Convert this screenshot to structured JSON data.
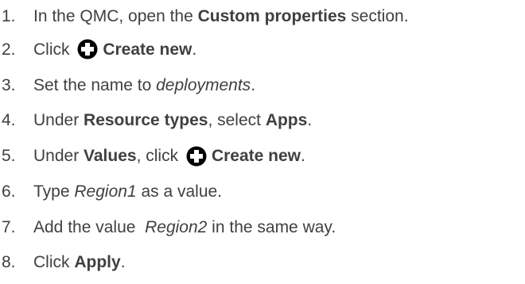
{
  "steps": [
    {
      "number": "1.",
      "parts": [
        {
          "t": "In the QMC, open the ",
          "s": "n"
        },
        {
          "t": "Custom properties",
          "s": "b"
        },
        {
          "t": " section.",
          "s": "n"
        }
      ]
    },
    {
      "number": "2.",
      "parts": [
        {
          "t": "Click ",
          "s": "n"
        },
        {
          "icon": "plus-circle-icon"
        },
        {
          "t": "Create new",
          "s": "b"
        },
        {
          "t": ".",
          "s": "n"
        }
      ]
    },
    {
      "number": "3.",
      "parts": [
        {
          "t": "Set the name to ",
          "s": "n"
        },
        {
          "t": "deployments",
          "s": "i"
        },
        {
          "t": ".",
          "s": "n"
        }
      ]
    },
    {
      "number": "4.",
      "parts": [
        {
          "t": "Under ",
          "s": "n"
        },
        {
          "t": "Resource types",
          "s": "b"
        },
        {
          "t": ", select ",
          "s": "n"
        },
        {
          "t": "Apps",
          "s": "b"
        },
        {
          "t": ".",
          "s": "n"
        }
      ]
    },
    {
      "number": "5.",
      "parts": [
        {
          "t": "Under ",
          "s": "n"
        },
        {
          "t": "Values",
          "s": "b"
        },
        {
          "t": ", click ",
          "s": "n"
        },
        {
          "icon": "plus-circle-icon"
        },
        {
          "t": "Create new",
          "s": "b"
        },
        {
          "t": ".",
          "s": "n"
        }
      ]
    },
    {
      "number": "6.",
      "parts": [
        {
          "t": "Type ",
          "s": "n"
        },
        {
          "t": "Region1",
          "s": "i"
        },
        {
          "t": " as a value.",
          "s": "n"
        }
      ]
    },
    {
      "number": "7.",
      "parts": [
        {
          "t": "Add the value  ",
          "s": "n"
        },
        {
          "t": "Region2",
          "s": "i"
        },
        {
          "t": " in the same way.",
          "s": "n"
        }
      ]
    },
    {
      "number": "8.",
      "parts": [
        {
          "t": "Click ",
          "s": "n"
        },
        {
          "t": "Apply",
          "s": "b"
        },
        {
          "t": ".",
          "s": "n"
        }
      ]
    }
  ],
  "colors": {
    "text": "#404040",
    "icon": "#000000"
  }
}
